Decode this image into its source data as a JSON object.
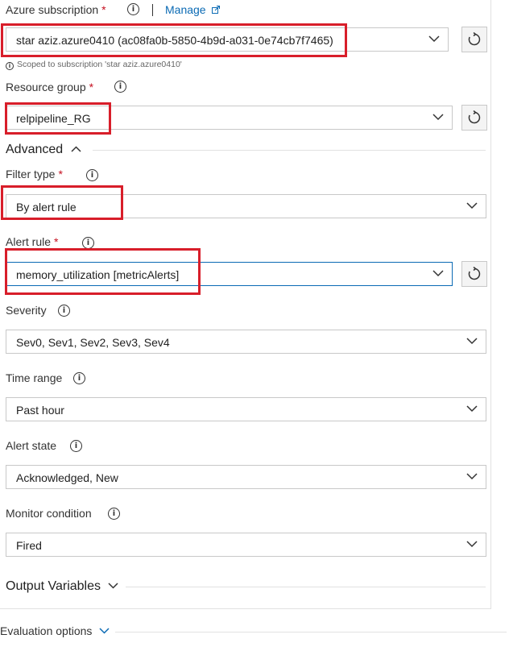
{
  "subscription": {
    "label": "Azure subscription",
    "required": "*",
    "manage_label": "Manage",
    "value": "star aziz.azure0410 (ac08fa0b-5850-4b9d-a031-0e74cb7f7465)",
    "hint": "Scoped to subscription 'star aziz.azure0410'"
  },
  "resource_group": {
    "label": "Resource group",
    "required": "*",
    "value": "relpipeline_RG"
  },
  "advanced": {
    "label": "Advanced"
  },
  "filter_type": {
    "label": "Filter type",
    "required": "*",
    "value": "By alert rule"
  },
  "alert_rule": {
    "label": "Alert rule",
    "required": "*",
    "value": "memory_utilization [metricAlerts]"
  },
  "severity": {
    "label": "Severity",
    "value": "Sev0, Sev1, Sev2, Sev3, Sev4"
  },
  "time_range": {
    "label": "Time range",
    "value": "Past hour"
  },
  "alert_state": {
    "label": "Alert state",
    "value": "Acknowledged, New"
  },
  "monitor_condition": {
    "label": "Monitor condition",
    "value": "Fired"
  },
  "output_variables": {
    "label": "Output Variables"
  },
  "evaluation_options": {
    "label": "Evaluation options"
  },
  "info_glyph": "i",
  "icons": [
    "info-icon",
    "external-link-icon",
    "chevron-down-icon",
    "chevron-up-icon",
    "refresh-icon"
  ],
  "colors": {
    "highlight": "#d81e2a",
    "link": "#0a6ab4",
    "required": "#c50f1f"
  }
}
